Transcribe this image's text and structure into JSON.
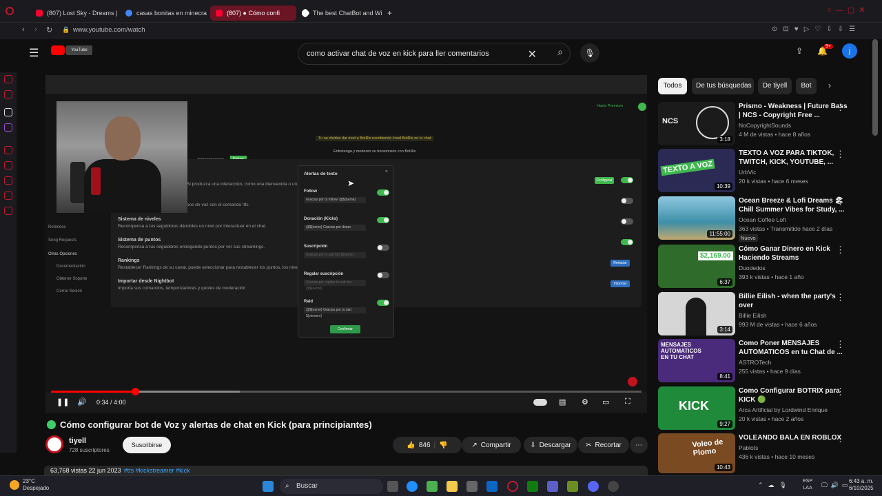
{
  "browser": {
    "tabs": [
      {
        "label": "(807) Lost Sky - Dreams |",
        "color": "#ff0033"
      },
      {
        "label": "casas bonitas en minecra",
        "color": "#4285f4"
      },
      {
        "label": "(807) ● Cómo confi",
        "color": "#ff0033"
      },
      {
        "label": "The best ChatBot and Wi",
        "color": "#ffffff"
      }
    ],
    "new_tab": "+",
    "url": "www.youtube.com/watch"
  },
  "youtube": {
    "logo": "YouTube",
    "search_query": "como activar chat de voz en kick para ller comentarios",
    "notifications": "9+",
    "avatar_letter": "j"
  },
  "embedded": {
    "topnotice": "Tu no olvides dar mod a BotRix escribiendo /mod BotRix en tu chat",
    "subheader": "Entretenga y moderen su transmisión con BotRix",
    "tabs": [
      "Temporizadores",
      "Extras"
    ],
    "premium": "Hazte Premium",
    "nav": [
      "Referidos",
      "Song Requests",
      "Otras Opciones",
      "Documentación",
      "Obtener Soporte",
      "Cerrar Sesión"
    ],
    "rows": [
      {
        "title": "Sistema de niveles",
        "text": "Recompensa a tus seguidores dándoles un nivel por interactuar en el chat."
      },
      {
        "title": "Sistema de puntos",
        "text": "Recompensa a tus seguidores entregando puntos por ver sus streamings."
      },
      {
        "title": "Rankings",
        "text": "Restablecer Rankings de su canal, puede seleccionar para restablecer los puntos, los niveles o ambos."
      },
      {
        "title": "Importar desde Nightbot",
        "text": "Importa sus comandos, temporizadores y quotes de moderación"
      }
    ],
    "line1": "Si produzca una interacción, como una bienvenida o un follow.",
    "line2": "pos de voz con el comando !tts",
    "btn_config": "Configurar",
    "btn_reset": "Reiniciar",
    "btn_import": "Importar",
    "modal": {
      "title": "Alertas de texto",
      "close": "×",
      "items": [
        {
          "label": "Follow",
          "value": "Gracias por tu follow! @${name}",
          "on": true
        },
        {
          "label": "Donación (Kicks)",
          "value": "@${name} Gracias por donar",
          "on": true
        },
        {
          "label": "Suscripción",
          "value": "Gracias por la sub bro ${name}",
          "on": false
        },
        {
          "label": "Regalar suscripción",
          "value": "Gracias por regalar la sub bro @${name}",
          "on": false
        },
        {
          "label": "Raid",
          "value": "@${name} Gracias por la raid ${viewers}",
          "on": true
        }
      ],
      "confirm": "Confirmar"
    }
  },
  "player": {
    "current": "0:34",
    "duration": "4:00",
    "time_label": "0:34 / 4:00",
    "played_fraction": 0.142,
    "buffered_fraction": 0.32
  },
  "video": {
    "title": "Cómo configurar bot de Voz y alertas de chat en Kick (para principiantes)",
    "channel": "tiyell",
    "subscribers": "728 suscriptores",
    "subscribe_label": "Suscribirse",
    "likes": "846",
    "share_label": "Compartir",
    "download_label": "Descargar",
    "clip_label": "Recortar",
    "views_date": "63,768 vistas  22 jun 2023",
    "tags": "#tts #kickstreamer #kick"
  },
  "sidebar": {
    "chips": [
      "Todos",
      "De tus búsquedas",
      "De tiyell",
      "Bot"
    ],
    "recommendations": [
      {
        "title": "Prismo - Weakness | Future Bass | NCS - Copyright Free ...",
        "channel": "NoCopyrightSounds",
        "meta": "4 M de vistas • hace 8 años",
        "duration": "3:18",
        "thumb": "#1b1b1b"
      },
      {
        "title": "TEXTO A VOZ PARA TIKTOK, TWITCH, KICK, YOUTUBE, ...",
        "channel": "UrbVic",
        "meta": "20 k vistas • hace 6 meses",
        "duration": "10:39",
        "thumb": "#2a2a55"
      },
      {
        "title": "Ocean Breeze & Lofi Dreams 🏖 Chill Summer Vibes for Study, ...",
        "channel": "Ocean Coffee Lofi",
        "meta": "363 vistas • Transmitido hace 2 días",
        "duration": "11:55:00",
        "thumb": "#5f9fb0",
        "badge": "Nuevo"
      },
      {
        "title": "Cómo Ganar Dinero en Kick Haciendo Streams",
        "channel": "Duodedos",
        "meta": "393 k vistas • hace 1 año",
        "duration": "6:37",
        "thumb": "#2f6b2a"
      },
      {
        "title": "Billie Eilish - when the party's over",
        "channel": "Billie Eilish",
        "meta": "993 M de vistas • hace 6 años",
        "duration": "3:14",
        "thumb": "#d6d6d6"
      },
      {
        "title": "Como Poner MENSAJES AUTOMATICOS en tu Chat de ...",
        "channel": "ASTROTech",
        "meta": "255 vistas • hace 9 días",
        "duration": "8:41",
        "thumb": "#4a2a7a"
      },
      {
        "title": "Como Configurar BOTRIX para KICK 🟢",
        "channel": "Arca Artificial by Lordwind Enrique",
        "meta": "20 k vistas • hace 2 años",
        "duration": "9:27",
        "thumb": "#1f8a3a"
      },
      {
        "title": "VOLEANDO BALA EN ROBLOX",
        "channel": "Pablots",
        "meta": "436 k vistas • hace 10 meses",
        "duration": "10:43",
        "thumb": "#7a4a22"
      }
    ]
  },
  "taskbar": {
    "temp": "23°C",
    "weather": "Despejado",
    "search": "Buscar",
    "lang1": "ESP",
    "lang2": "LAA",
    "time": "6:43 a. m.",
    "date": "6/10/2025"
  },
  "colors": {
    "accent": "#ff0000",
    "kick_green": "#3fb84e",
    "link": "#3ea6ff"
  }
}
